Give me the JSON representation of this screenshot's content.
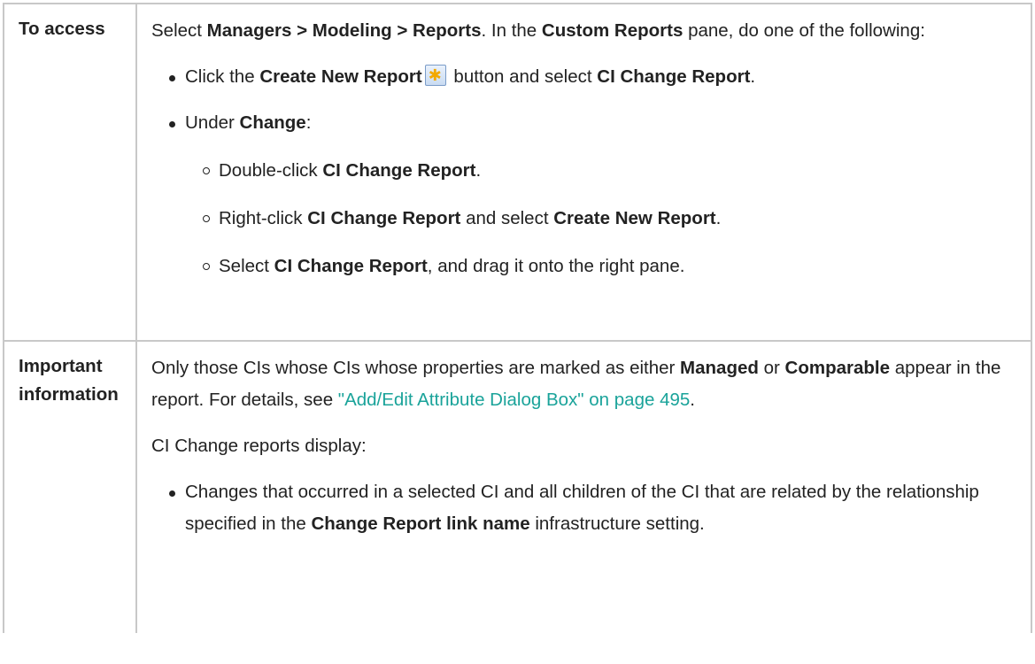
{
  "access": {
    "label": "To access",
    "intro": {
      "t1": "Select ",
      "menu_path": "Managers > Modeling > Reports",
      "t2": ". In the ",
      "pane": "Custom Reports",
      "t3": " pane, do one of the following:"
    },
    "bullet1": {
      "t1": "Click the ",
      "button": "Create New Report",
      "t2": " button and select ",
      "report": "CI Change Report",
      "t3": "."
    },
    "bullet2": {
      "t1": "Under ",
      "category": "Change",
      "t2": ":",
      "sub": [
        {
          "t1": "Double-click ",
          "b1": "CI Change Report",
          "t2": "."
        },
        {
          "t1": "Right-click ",
          "b1": "CI Change Report",
          "t2": " and select ",
          "b2": "Create New Report",
          "t3": "."
        },
        {
          "t1": "Select ",
          "b1": "CI Change Report",
          "t2": ", and drag it onto the right pane."
        }
      ]
    },
    "create_icon": "create-new-report-icon"
  },
  "important": {
    "label": "Important information",
    "para1": {
      "t1": "Only those CIs whose CIs whose properties are marked as either ",
      "b1": "Managed",
      "t2": " or ",
      "b2": "Comparable",
      "t3": " appear in the report. For details, see ",
      "link": "\"Add/Edit Attribute Dialog Box\" on page 495",
      "t4": "."
    },
    "para2": "CI Change reports display:",
    "bullet1": {
      "t1": "Changes that occurred in a selected CI and all children of the CI that are related by the relationship specified in the ",
      "b1": "Change Report link name",
      "t2": " infrastructure setting."
    }
  },
  "colors": {
    "link": "#1aa39a",
    "border": "#c8c8c8"
  }
}
